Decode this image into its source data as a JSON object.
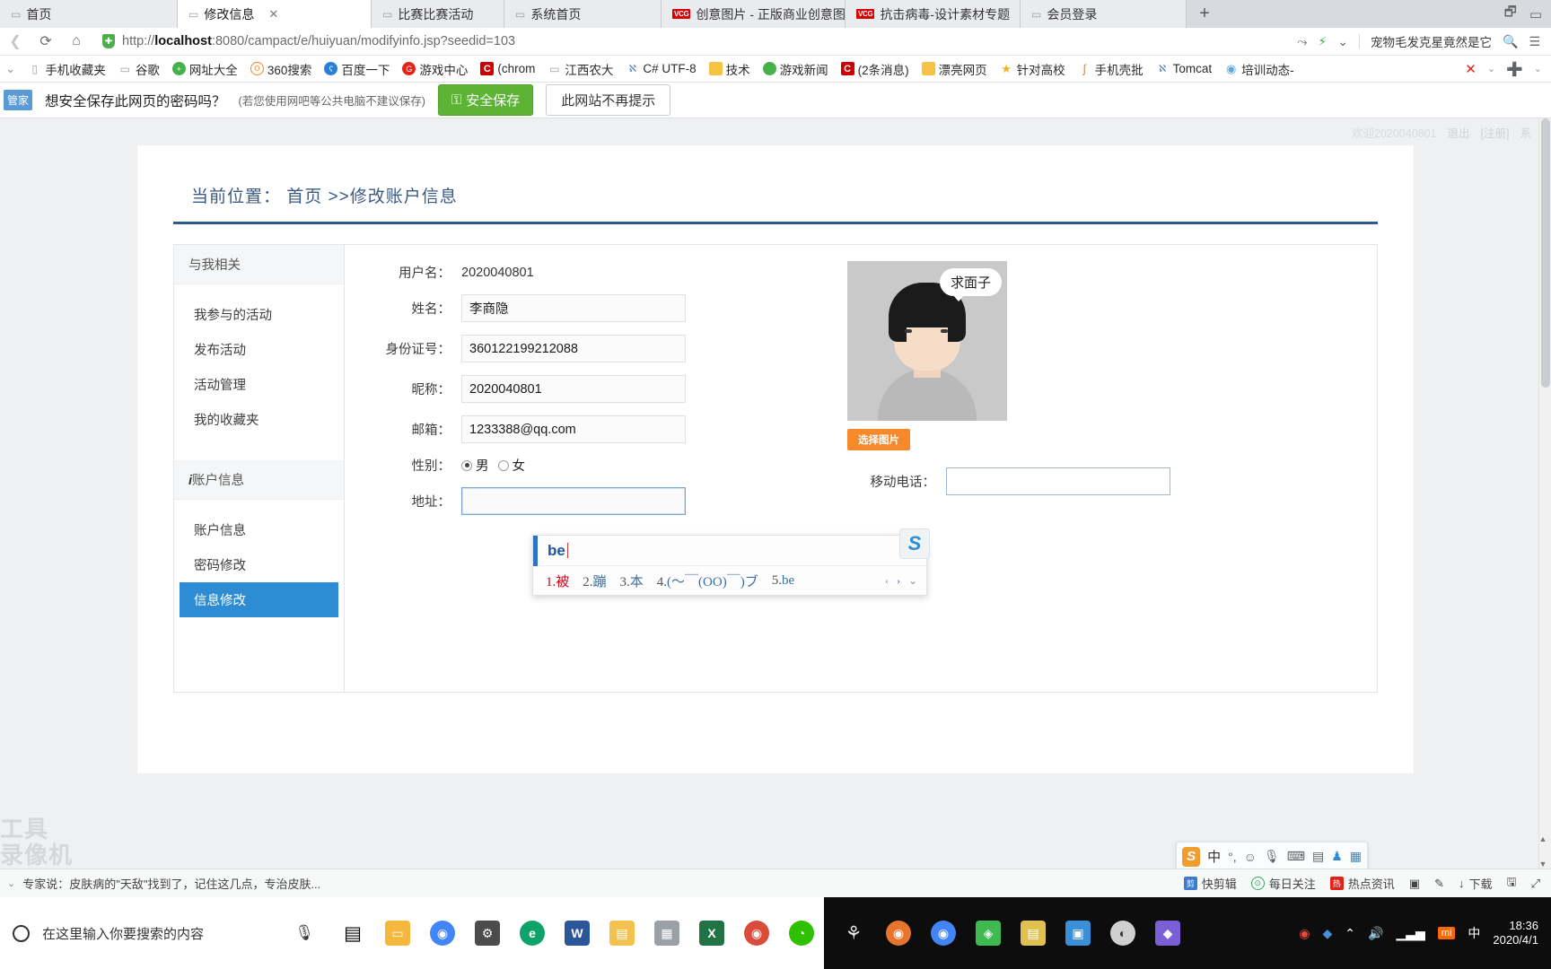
{
  "browser": {
    "tabs": [
      {
        "title": "首页",
        "icon": "page-icon",
        "active": false,
        "closable": false
      },
      {
        "title": "修改信息",
        "icon": "page-icon",
        "active": true,
        "closable": true,
        "close_label": "✕"
      },
      {
        "title": "比赛比赛活动",
        "icon": "page-icon",
        "active": false,
        "closable": false
      },
      {
        "title": "系统首页",
        "icon": "page-icon",
        "active": false,
        "closable": false
      },
      {
        "title": "创意图片 - 正版商业创意图",
        "icon": "vcg-icon",
        "badge": "VCG",
        "active": false,
        "closable": false
      },
      {
        "title": "抗击病毒-设计素材专题",
        "icon": "vcg-icon",
        "badge": "VCG",
        "active": false,
        "closable": false
      },
      {
        "title": "会员登录",
        "icon": "page-icon",
        "active": false,
        "closable": false
      }
    ],
    "new_tab_label": "+",
    "tabstrip_right": [
      "🗗",
      "▭"
    ],
    "nav": {
      "back": "❮",
      "reload": "⟳",
      "home": "⌂"
    },
    "url": {
      "scheme": "http://",
      "host": "localhost",
      "rest": ":8080/campact/e/huiyuan/modifyinfo.jsp?seedid=103"
    },
    "addr_right": {
      "share": "⤳",
      "lightning": "⚡",
      "chevron": "⌄",
      "hint": "宠物毛发克星竟然是它",
      "search": "🔍",
      "menu": "☰"
    },
    "bookmarks": [
      {
        "label": "手机收藏夹",
        "icon": "phone-icon",
        "style": "ic-page"
      },
      {
        "label": "谷歌",
        "icon": "page-icon",
        "style": "ic-page"
      },
      {
        "label": "网址大全",
        "icon": "green-plus-icon",
        "style": "ic-green",
        "glyph": "+"
      },
      {
        "label": "360搜索",
        "icon": "orange-circle-icon",
        "style": "ic-orange",
        "glyph": "O"
      },
      {
        "label": "百度一下",
        "icon": "baidu-icon",
        "style": "ic-blue",
        "glyph": "熊"
      },
      {
        "label": "游戏中心",
        "icon": "red-circle-icon",
        "style": "ic-red",
        "glyph": "G"
      },
      {
        "label": "(chrom",
        "icon": "chrome-icon",
        "style": "ic-redsq",
        "glyph": "C"
      },
      {
        "label": "江西农大",
        "icon": "page-icon",
        "style": "ic-page"
      },
      {
        "label": "C# UTF-8",
        "icon": "text-icon",
        "style": "ic-txt",
        "glyph": "ℵ"
      },
      {
        "label": "技术",
        "icon": "folder-icon",
        "style": "ic-folder",
        "glyph": "▬"
      },
      {
        "label": "游戏新闻",
        "icon": "green-circle-icon",
        "style": "ic-green",
        "glyph": "●"
      },
      {
        "label": "(2条消息)",
        "icon": "chrome-icon",
        "style": "ic-redsq",
        "glyph": "C"
      },
      {
        "label": "漂亮网页",
        "icon": "folder-icon",
        "style": "ic-folder",
        "glyph": "▬"
      },
      {
        "label": "针对高校",
        "icon": "star-icon",
        "style": "ic-star",
        "glyph": "★"
      },
      {
        "label": "手机壳批",
        "icon": "swirl-icon",
        "style": "ic-swirl",
        "glyph": "S"
      },
      {
        "label": "Tomcat",
        "icon": "text-icon",
        "style": "ic-txt",
        "glyph": "ℵ"
      },
      {
        "label": "培训动态-",
        "icon": "globe-icon",
        "style": "ic-globe",
        "glyph": "◉"
      }
    ],
    "bookmarks_overflow": "⌄",
    "bookmarks_right": {
      "close": "✕",
      "chevron1": "⌄",
      "plus": "➕",
      "chevron2": "⌄"
    }
  },
  "password_bar": {
    "badge": "管家",
    "question": "想安全保存此网页的密码吗？",
    "note": "(若您使用网吧等公共电脑不建议保存)",
    "save_label": "安全保存",
    "save_icon": "key-icon",
    "never_label": "此网站不再提示"
  },
  "site": {
    "welcome_prefix": "欢迎",
    "username": "2020040801",
    "logout_label": "退出",
    "register_label": "[注册]",
    "extra": "系",
    "breadcrumb": "当前位置： 首页 >>修改账户信息"
  },
  "sidebar": {
    "sections": [
      {
        "header": "与我相关",
        "header_badge": "",
        "items": [
          {
            "label": "我参与的活动",
            "active": false
          },
          {
            "label": "发布活动",
            "active": false
          },
          {
            "label": "活动管理",
            "active": false
          },
          {
            "label": "我的收藏夹",
            "active": false
          }
        ]
      },
      {
        "header": "账户信息",
        "header_badge": "i",
        "items": [
          {
            "label": "账户信息",
            "active": false
          },
          {
            "label": "密码修改",
            "active": false
          },
          {
            "label": "信息修改",
            "active": true
          }
        ]
      }
    ]
  },
  "form": {
    "fields": [
      {
        "label": "用户名：",
        "value": "2020040801",
        "type": "static",
        "name": "username"
      },
      {
        "label": "姓名：",
        "value": "李商隐",
        "type": "input",
        "name": "realname"
      },
      {
        "label": "身份证号：",
        "value": "360122199212088",
        "type": "input",
        "name": "idcard"
      },
      {
        "label": "昵称：",
        "value": "2020040801",
        "type": "input",
        "name": "nickname"
      },
      {
        "label": "邮箱：",
        "value": "1233388@qq.com",
        "type": "input",
        "name": "email"
      }
    ],
    "gender": {
      "label": "性别：",
      "options": [
        {
          "label": "男",
          "selected": true
        },
        {
          "label": "女",
          "selected": false
        }
      ]
    },
    "address": {
      "label": "地址：",
      "value": "",
      "focused": true
    },
    "phone": {
      "label": "移动电话：",
      "value": ""
    },
    "avatar": {
      "bubble_text": "求面子",
      "button_label": "选择图片"
    }
  },
  "ime": {
    "composition": "be",
    "candidates": [
      {
        "num": "1.",
        "text": "被"
      },
      {
        "num": "2.",
        "text": "蹦"
      },
      {
        "num": "3.",
        "text": "本"
      },
      {
        "num": "4.",
        "text": "(～￣(OO)￣)ブ"
      },
      {
        "num": "5.",
        "text": "be"
      }
    ],
    "prev": "‹",
    "next": "›",
    "more": "⌄",
    "logo": "S"
  },
  "ime_toolbar": {
    "logo": "S",
    "mode_label": "中",
    "items": [
      {
        "icon": "punctuation-icon",
        "glyph": "°,"
      },
      {
        "icon": "emoji-icon",
        "glyph": "☺"
      },
      {
        "icon": "mic-icon",
        "glyph": "🎤"
      },
      {
        "icon": "keyboard-icon",
        "glyph": "⌨"
      },
      {
        "icon": "toolbox-icon",
        "glyph": "🧰"
      },
      {
        "icon": "hat-icon",
        "glyph": "♟"
      },
      {
        "icon": "grid-icon",
        "glyph": "▦"
      }
    ]
  },
  "watermark": {
    "line1": "工具",
    "line2": "录像机"
  },
  "news_bar": {
    "chevron": "⌄",
    "text": "专家说：皮肤病的\"天敌\"找到了，记住这几点，专治皮肤...",
    "right_items": [
      {
        "label": "快剪辑",
        "badge": "剪",
        "style": "blue"
      },
      {
        "label": "每日关注",
        "badge": "⊙",
        "style": "green"
      },
      {
        "label": "热点资讯",
        "badge": "热",
        "style": "red"
      },
      {
        "label": "",
        "badge": "▣",
        "style": "plain"
      },
      {
        "label": "",
        "badge": "✎",
        "style": "plain"
      },
      {
        "label": "下载",
        "badge": "↓",
        "style": "plain"
      },
      {
        "label": "",
        "badge": "🖫",
        "style": "plain"
      },
      {
        "label": "",
        "badge": "⤢",
        "style": "plain"
      }
    ]
  },
  "taskbar": {
    "search_placeholder": "在这里输入你要搜索的内容",
    "search_icon": "search-circle-icon",
    "mic_icon": "microphone-icon",
    "taskview_icon": "task-view-icon",
    "apps": [
      {
        "name": "file-explorer-icon",
        "glyph": "📁",
        "color": "#f5b83d"
      },
      {
        "name": "chrome-icon",
        "glyph": "◉",
        "color": "#4285f4"
      },
      {
        "name": "settings-icon",
        "glyph": "⚙",
        "color": "#4c4c4c"
      },
      {
        "name": "edge-icon",
        "glyph": "e",
        "color": "#0fa36b"
      },
      {
        "name": "word-icon",
        "glyph": "W",
        "color": "#2b579a"
      },
      {
        "name": "folder-icon",
        "glyph": "🗂",
        "color": "#f2c14e"
      },
      {
        "name": "photos-icon",
        "glyph": "🖼",
        "color": "#9aa0a6"
      },
      {
        "name": "excel-icon",
        "glyph": "X",
        "color": "#217346"
      },
      {
        "name": "app-icon",
        "glyph": "◉",
        "color": "#d94b3a"
      },
      {
        "name": "wechat-icon",
        "glyph": "💬",
        "color": "#2dc100"
      }
    ],
    "dark_apps": [
      {
        "name": "people-icon",
        "glyph": "⚘",
        "color": "#cfcfcf"
      },
      {
        "name": "app-orange-icon",
        "glyph": "◉",
        "color": "#e8752e"
      },
      {
        "name": "app-chrome-icon",
        "glyph": "◉",
        "color": "#4285f4"
      },
      {
        "name": "app-green-icon",
        "glyph": "◈",
        "color": "#3fb950"
      },
      {
        "name": "app-folder-icon",
        "glyph": "▤",
        "color": "#e0c04e"
      },
      {
        "name": "app-blue-icon",
        "glyph": "▣",
        "color": "#3a8fd6"
      },
      {
        "name": "app-browser-icon",
        "glyph": "◐",
        "color": "#d0d0d0"
      },
      {
        "name": "app-purple-icon",
        "glyph": "◆",
        "color": "#7a5fd6"
      }
    ],
    "tray": [
      {
        "name": "tray-red-icon",
        "glyph": "◉",
        "color": "#e24c3f"
      },
      {
        "name": "tray-blue-icon",
        "glyph": "◆",
        "color": "#4a90d9"
      },
      {
        "name": "tray-chevron-icon",
        "glyph": "⌃",
        "color": "#ffffff"
      },
      {
        "name": "volume-icon",
        "glyph": "🔊",
        "color": "#ffffff"
      },
      {
        "name": "network-icon",
        "glyph": "📶",
        "color": "#ffffff"
      }
    ],
    "mi_badge": "mi",
    "ime_mode": "中",
    "time": "18:36",
    "date": "2020/4/1"
  }
}
